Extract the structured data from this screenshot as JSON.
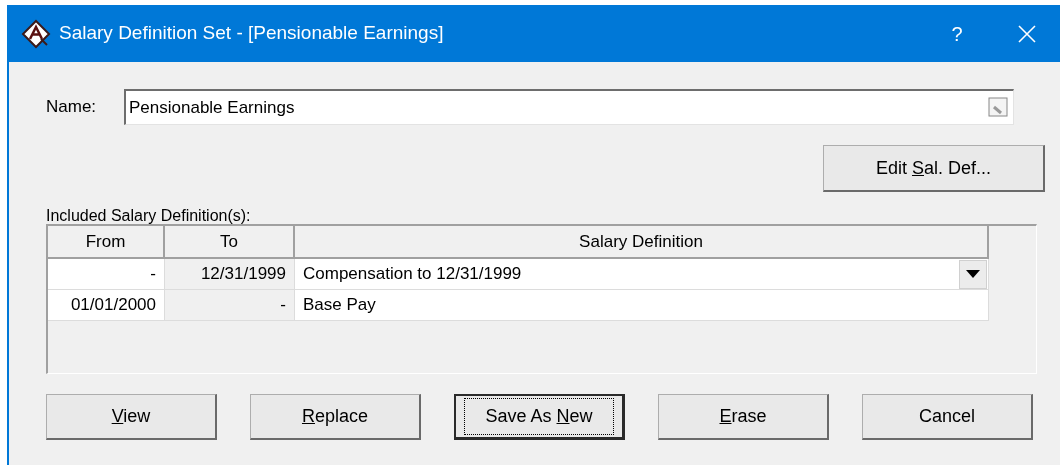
{
  "window": {
    "title": "Salary Definition Set - [Pensionable Earnings]",
    "help": "?"
  },
  "name_field": {
    "label": "Name:",
    "value": "Pensionable Earnings"
  },
  "edit_button": {
    "text_before": "Edit ",
    "mnemonic": "S",
    "text_after": "al. Def..."
  },
  "table": {
    "caption": "Included Salary Definition(s):",
    "columns": [
      "From",
      "To",
      "Salary Definition"
    ],
    "rows": [
      {
        "cells": [
          "-",
          "12/31/1999",
          "Compensation to 12/31/1999"
        ],
        "editing": true
      },
      {
        "cells": [
          "01/01/2000",
          "-",
          "Base Pay"
        ],
        "editing": false
      }
    ]
  },
  "buttons": [
    {
      "mnemonic": "V",
      "text_after": "iew",
      "focused": false
    },
    {
      "mnemonic": "R",
      "text_after": "eplace",
      "focused": false
    },
    {
      "text_before": "Save As ",
      "mnemonic": "N",
      "text_after": "ew",
      "focused": true
    },
    {
      "mnemonic": "E",
      "text_after": "rase",
      "focused": false
    },
    {
      "text_after": "Cancel",
      "focused": false
    }
  ]
}
